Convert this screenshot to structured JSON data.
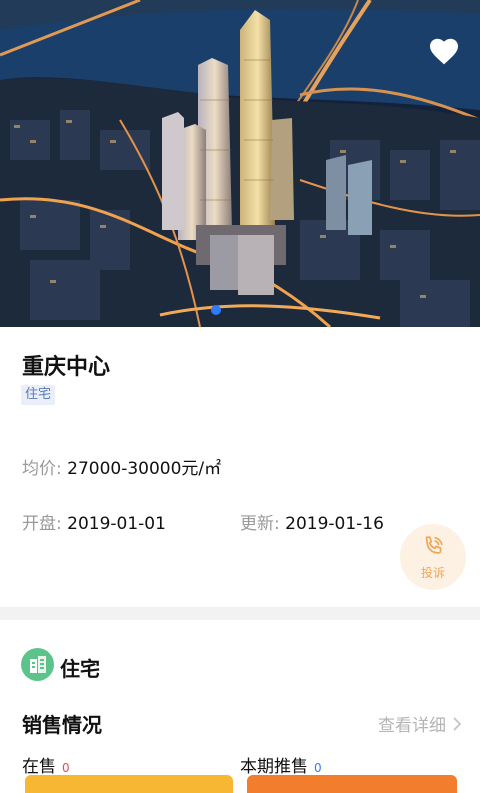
{
  "property": {
    "name": "重庆中心",
    "type_tag": "住宅",
    "price_label": "均价",
    "price_value": "27000-30000元/㎡",
    "open_label": "开盘",
    "open_value": "2019-01-01",
    "update_label": "更新",
    "update_value": "2019-01-16"
  },
  "complain": {
    "label": "投诉"
  },
  "section": {
    "title": "住宅",
    "sales_title": "销售情况",
    "view_detail": "查看详细",
    "partial_left": "在售",
    "partial_left_count": "0",
    "partial_right": "本期推售",
    "partial_right_count": "0"
  },
  "icons": {
    "favorite": "heart-icon",
    "complain": "phone-icon",
    "section": "building-icon",
    "chevron": "chevron-right-icon"
  },
  "colors": {
    "accent_blue": "#2f7bff",
    "complain_orange": "#f0a654",
    "section_green": "#5cc48a",
    "btn_yellow": "#f7b733",
    "btn_orange": "#f27d2c"
  }
}
